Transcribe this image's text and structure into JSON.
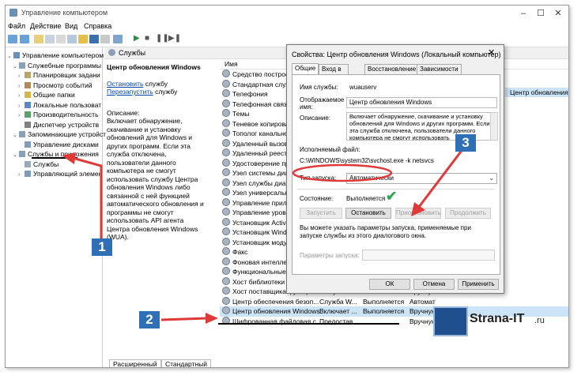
{
  "window": {
    "title": "Управление компьютером"
  },
  "menu": [
    "Файл",
    "Действие",
    "Вид",
    "Справка"
  ],
  "tree": [
    {
      "label": "Управление компьютером (л",
      "level": 0,
      "expander": "v"
    },
    {
      "label": "Служебные программы",
      "level": 1,
      "expander": "v"
    },
    {
      "label": "Планировщик задани",
      "level": 2,
      "expander": ">"
    },
    {
      "label": "Просмотр событий",
      "level": 2,
      "expander": ">"
    },
    {
      "label": "Общие папки",
      "level": 2,
      "expander": ">"
    },
    {
      "label": "Локальные пользоват",
      "level": 2,
      "expander": ">"
    },
    {
      "label": "Производительность",
      "level": 2,
      "expander": ">"
    },
    {
      "label": "Диспетчер устройств",
      "level": 2,
      "expander": ""
    },
    {
      "label": "Запоминающие устройст",
      "level": 1,
      "expander": "v"
    },
    {
      "label": "Управление дисками",
      "level": 2,
      "expander": ""
    },
    {
      "label": "Службы и приложения",
      "level": 1,
      "expander": "v"
    },
    {
      "label": "Службы",
      "level": 2,
      "expander": ""
    },
    {
      "label": "Управляющий элемен",
      "level": 2,
      "expander": ">"
    }
  ],
  "services_pane": {
    "header": "Службы",
    "selected_title": "Центр обновления Windows",
    "link_stop": "Остановить",
    "link_stop_suffix": " службу",
    "link_restart": "Перезапустить",
    "link_restart_suffix": " службу",
    "desc_label": "Описание:",
    "desc_text": "Включает обнаружение, скачивание и установку обновлений для Windows и других программ. Если эта служба отключена, пользователи данного компьютера не смогут использовать службу Центра обновления Windows либо связанной с ней функцией автоматического обновления и программы не смогут использовать API агента Центра обновления Windows (WUA).",
    "col_name": "Имя",
    "rows": [
      {
        "name": "Средство построен"
      },
      {
        "name": "Стандартная служба"
      },
      {
        "name": "Телефония"
      },
      {
        "name": "Телефонная связь"
      },
      {
        "name": "Темы"
      },
      {
        "name": "Теневое копирован"
      },
      {
        "name": "Тополог канального"
      },
      {
        "name": "Удаленный вызов пр"
      },
      {
        "name": "Удаленный реестр"
      },
      {
        "name": "Удостоверение прил"
      },
      {
        "name": "Узел системы диагн"
      },
      {
        "name": "Узел службы диагно"
      },
      {
        "name": "Узел универсальны"
      },
      {
        "name": "Управление прилож"
      },
      {
        "name": "Управление уровнями"
      },
      {
        "name": "Установщик ActiveX"
      },
      {
        "name": "Установщик Window"
      },
      {
        "name": "Установщик модулей"
      },
      {
        "name": "Факс"
      },
      {
        "name": "Фоновая интеллекту"
      },
      {
        "name": "Функциональные воз"
      },
      {
        "name": "Хост библиотеки сч"
      },
      {
        "name": "Хост поставщика функци...",
        "desc": "В службе",
        "status": "Выполняется",
        "startup": "Вручную"
      },
      {
        "name": "Центр обеспечения безоп...",
        "desc": "Служба W...",
        "status": "Выполняется",
        "startup": "Автомат"
      },
      {
        "name": "Центр обновления Windows",
        "desc": "Включает ...",
        "status": "Выполняется",
        "startup": "Вручную",
        "selected": true
      },
      {
        "name": "Шифрованная файловая с...",
        "desc": "Предостав...",
        "status": "",
        "startup": "Вручную"
      }
    ],
    "tab_extended": "Расширенный",
    "tab_standard": "Стандартный"
  },
  "right_pane": {
    "selected_label": "Центр обновления Windows"
  },
  "dialog": {
    "title": "Свойства: Центр обновления Windows (Локальный компьютер)",
    "tabs": [
      "Общие",
      "Вход в систему",
      "Восстановление",
      "Зависимости"
    ],
    "service_name_label": "Имя службы:",
    "service_name": "wuauserv",
    "display_name_label": "Отображаемое имя:",
    "display_name": "Центр обновления Windows",
    "description_label": "Описание:",
    "description": "Включает обнаружение, скачивание и установку обновлений для Windows и других программ. Если эта служба отключена, пользователи данного компьютера не смогут использовать",
    "exe_label": "Исполняемый файл:",
    "exe_path": "C:\\WINDOWS\\system32\\svchost.exe -k netsvcs",
    "startup_label": "Тип запуска:",
    "startup_value": "Автоматически",
    "state_label": "Состояние:",
    "state_value": "Выполняется",
    "btn_start": "Запустить",
    "btn_stop": "Остановить",
    "btn_pause": "Приостановить",
    "btn_resume": "Продолжить",
    "hint": "Вы можете указать параметры запуска, применяемые при запуске службы из этого диалогового окна.",
    "params_label": "Параметры запуска:",
    "btn_ok": "ОК",
    "btn_cancel": "Отмена",
    "btn_apply": "Применить"
  },
  "markers": [
    "1",
    "2",
    "3"
  ],
  "logo": {
    "text": "Strana-IT",
    "suffix": ".ru"
  },
  "colors": {
    "arrow": "#e0393a",
    "marker": "#2e6fb5",
    "selection": "#cce4f7",
    "check": "#2fa84f"
  }
}
